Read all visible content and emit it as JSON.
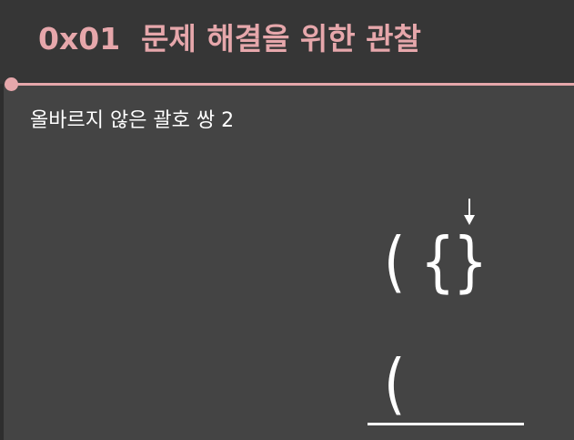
{
  "slide": {
    "title": "0x01  문제 해결을 위한 관찰",
    "subtitle": "올바르지 않은 괄호 쌍 2",
    "accent_color": "#e6a7ab",
    "input_brackets": [
      "(",
      "{",
      "}"
    ],
    "stack_brackets": [
      "("
    ]
  }
}
